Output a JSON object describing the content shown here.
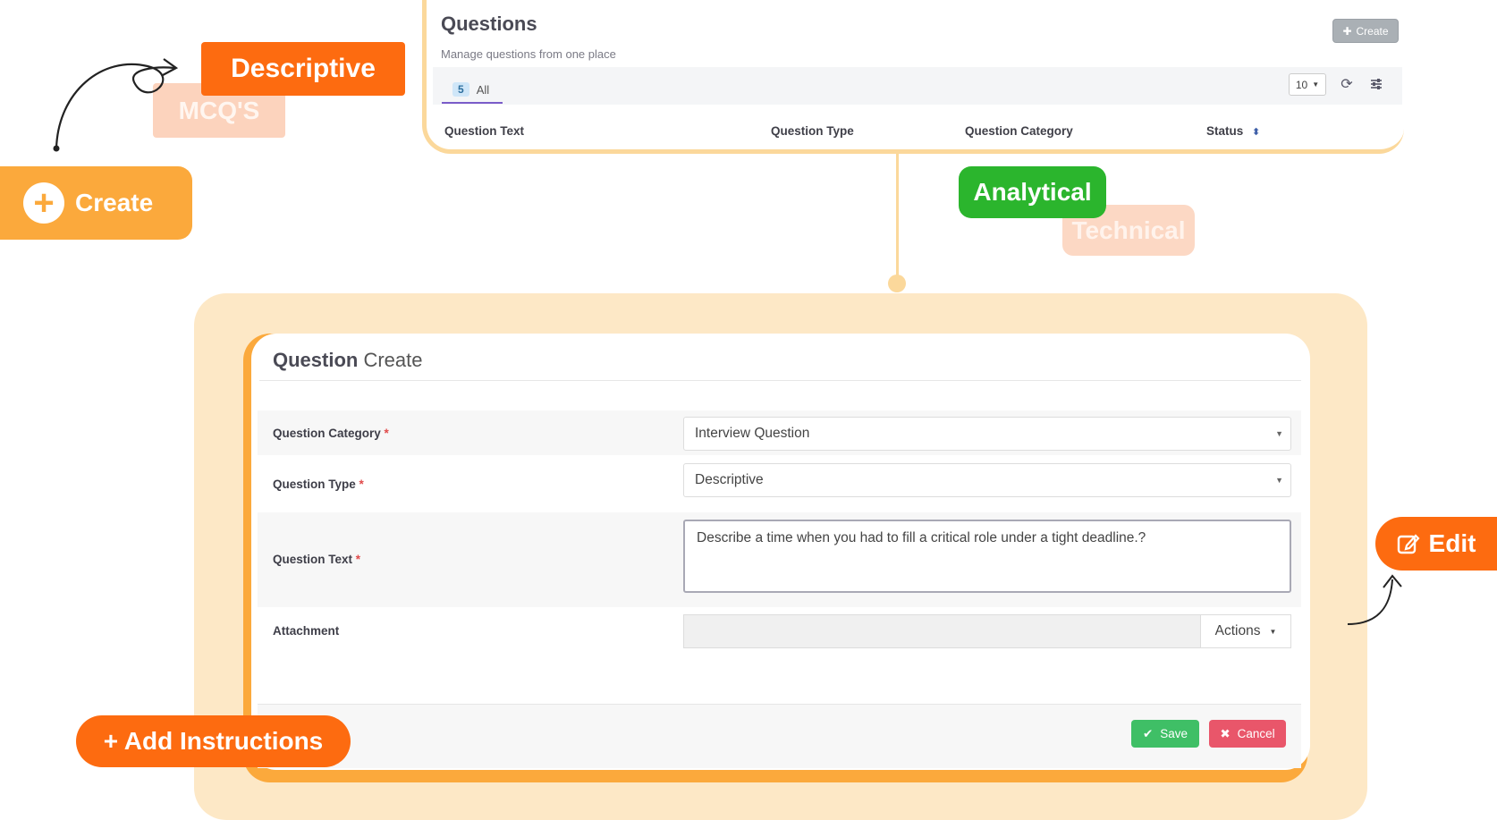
{
  "questions_panel": {
    "title": "Questions",
    "subtitle": "Manage questions from one place",
    "create_label": "Create",
    "tab": {
      "count": "5",
      "label": "All"
    },
    "per_page": "10",
    "columns": [
      "Question Text",
      "Question Type",
      "Question Category",
      "Status"
    ]
  },
  "annotations": {
    "descriptive": "Descriptive",
    "mcq": "MCQ'S",
    "create": "Create",
    "analytical": "Analytical",
    "technical": "Technical",
    "edit": "Edit",
    "add_instructions": "+ Add Instructions"
  },
  "form": {
    "title_bold": "Question",
    "title_rest": " Create",
    "fields": {
      "category": {
        "label": "Question Category",
        "value": "Interview Question"
      },
      "type": {
        "label": "Question Type",
        "value": "Descriptive"
      },
      "text": {
        "label": "Question Text",
        "value": "Describe a time when you had to fill a critical role under a tight deadline.?"
      },
      "attachment": {
        "label": "Attachment",
        "actions_label": "Actions"
      }
    },
    "required_mark": "*",
    "save_label": "Save",
    "cancel_label": "Cancel"
  },
  "colors": {
    "accent_orange": "#fd6b10",
    "accent_amber": "#fba93c",
    "accent_green": "#2bb52d",
    "panel_peach": "#fde8c6",
    "save_green": "#3fbf66",
    "cancel_red": "#e9566a"
  }
}
